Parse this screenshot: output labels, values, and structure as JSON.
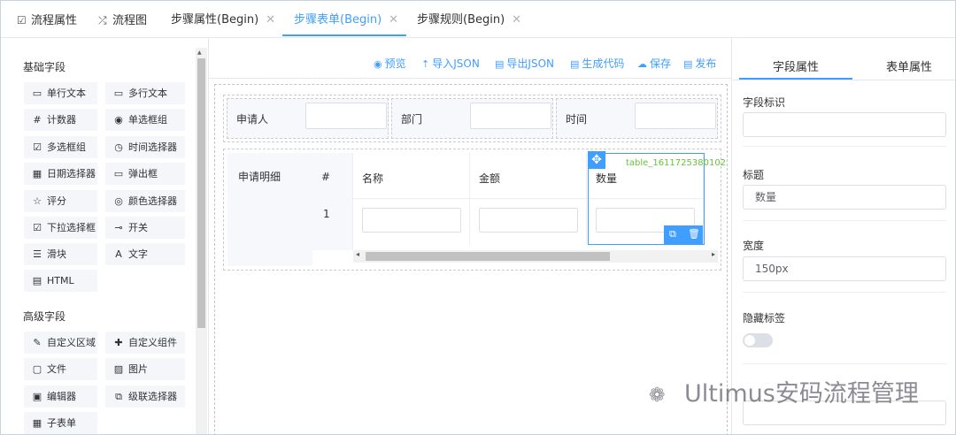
{
  "tabs": [
    {
      "label": "流程属性",
      "icon": "edit-icon"
    },
    {
      "label": "流程图",
      "icon": "shuffle-icon"
    },
    {
      "label": "步骤属性(Begin)",
      "closable": true
    },
    {
      "label": "步骤表单(Begin)",
      "closable": true,
      "active": true
    },
    {
      "label": "步骤规则(Begin)",
      "closable": true
    }
  ],
  "left_panel": {
    "basic_title": "基础字段",
    "basic_items": [
      {
        "label": "单行文本",
        "icon": "input-icon"
      },
      {
        "label": "多行文本",
        "icon": "textarea-icon"
      },
      {
        "label": "计数器",
        "icon": "number-icon"
      },
      {
        "label": "单选框组",
        "icon": "radio-icon"
      },
      {
        "label": "多选框组",
        "icon": "checkbox-icon"
      },
      {
        "label": "时间选择器",
        "icon": "clock-icon"
      },
      {
        "label": "日期选择器",
        "icon": "calendar-icon"
      },
      {
        "label": "弹出框",
        "icon": "popup-icon"
      },
      {
        "label": "评分",
        "icon": "star-icon"
      },
      {
        "label": "颜色选择器",
        "icon": "palette-icon"
      },
      {
        "label": "下拉选择框",
        "icon": "select-icon"
      },
      {
        "label": "开关",
        "icon": "switch-icon"
      },
      {
        "label": "滑块",
        "icon": "slider-icon"
      },
      {
        "label": "文字",
        "icon": "text-icon"
      },
      {
        "label": "HTML",
        "icon": "html-icon"
      }
    ],
    "advanced_title": "高级字段",
    "advanced_items": [
      {
        "label": "自定义区域",
        "icon": "custom-area-icon"
      },
      {
        "label": "自定义组件",
        "icon": "puzzle-icon"
      },
      {
        "label": "文件",
        "icon": "file-icon"
      },
      {
        "label": "图片",
        "icon": "image-icon"
      },
      {
        "label": "编辑器",
        "icon": "editor-icon"
      },
      {
        "label": "级联选择器",
        "icon": "cascader-icon"
      },
      {
        "label": "子表单",
        "icon": "table-icon"
      }
    ]
  },
  "toolbar": {
    "preview": "预览",
    "import_json": "导入JSON",
    "export_json": "导出JSON",
    "gen_code": "生成代码",
    "save": "保存",
    "publish": "发布"
  },
  "form": {
    "row1": [
      {
        "label": "申请人"
      },
      {
        "label": "部门"
      },
      {
        "label": "时间"
      }
    ],
    "detail_label": "申请明细",
    "subtable": {
      "index_header": "#",
      "columns": [
        "名称",
        "金额",
        "数量"
      ],
      "row_index": "1",
      "table_id": "table_1611725380102"
    }
  },
  "right_panel": {
    "tabs": [
      "字段属性",
      "表单属性"
    ],
    "field_id_label": "字段标识",
    "field_id_value": "",
    "title_label": "标题",
    "title_value": "数量",
    "width_label": "宽度",
    "width_value": "150px",
    "hide_label_label": "隐藏标签",
    "hide_label_on": false
  },
  "watermark": "Ultimus安码流程管理"
}
